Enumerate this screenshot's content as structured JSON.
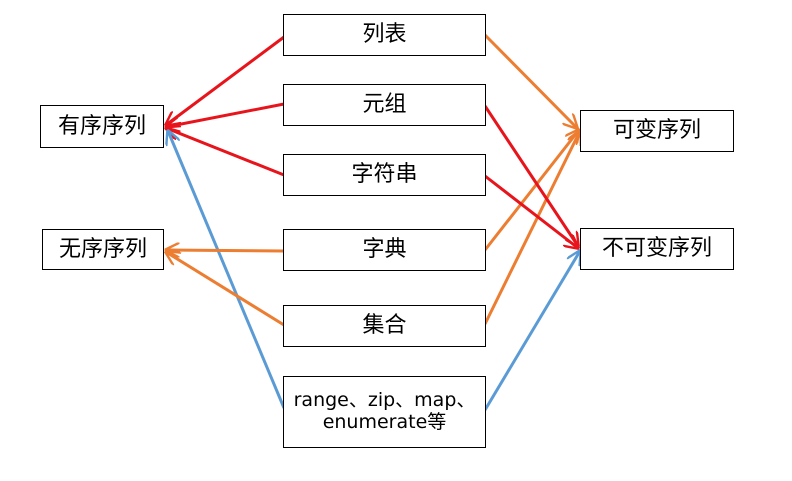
{
  "nodes": {
    "ordered": "有序序列",
    "unordered": "无序序列",
    "list": "列表",
    "tuple": "元组",
    "string": "字符串",
    "dict": "字典",
    "set": "集合",
    "others_line1": "range、zip、map、",
    "others_line2": "enumerate等",
    "mutable": "可变序列",
    "immutable": "不可变序列"
  },
  "colors": {
    "red": "#e8141c",
    "orange": "#ec7d31",
    "blue": "#5b9bd5"
  },
  "edges": [
    {
      "from": "列表",
      "to": "有序序列",
      "color": "red"
    },
    {
      "from": "元组",
      "to": "有序序列",
      "color": "red"
    },
    {
      "from": "字符串",
      "to": "有序序列",
      "color": "red"
    },
    {
      "from": "range、zip、map、enumerate等",
      "to": "有序序列",
      "color": "blue"
    },
    {
      "from": "字典",
      "to": "无序序列",
      "color": "orange"
    },
    {
      "from": "集合",
      "to": "无序序列",
      "color": "orange"
    },
    {
      "from": "列表",
      "to": "可变序列",
      "color": "orange"
    },
    {
      "from": "字典",
      "to": "可变序列",
      "color": "orange"
    },
    {
      "from": "集合",
      "to": "可变序列",
      "color": "orange"
    },
    {
      "from": "元组",
      "to": "不可变序列",
      "color": "red"
    },
    {
      "from": "字符串",
      "to": "不可变序列",
      "color": "red"
    },
    {
      "from": "range、zip、map、enumerate等",
      "to": "不可变序列",
      "color": "blue"
    }
  ]
}
